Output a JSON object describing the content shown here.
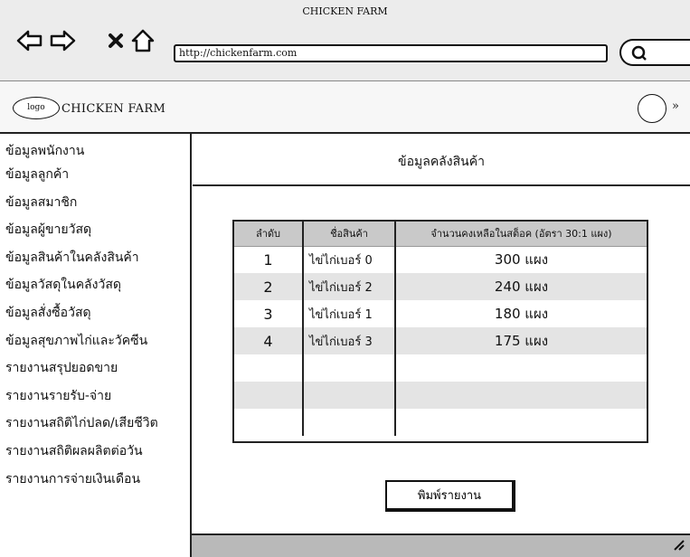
{
  "window": {
    "title": "CHICKEN FARM"
  },
  "browser": {
    "url": "http://chickenfarm.com",
    "back_icon": "back-arrow-icon",
    "forward_icon": "forward-arrow-icon",
    "close_icon": "close-icon",
    "home_icon": "home-icon",
    "search_icon": "search-icon"
  },
  "header": {
    "logo_text": "logo",
    "site_name": "CHICKEN FARM",
    "chevron": "»"
  },
  "sidebar": {
    "items": [
      {
        "label": "ข้อมูลพนักงาน"
      },
      {
        "label": "ข้อมูลลูกค้า"
      },
      {
        "label": "ข้อมูลสมาชิก"
      },
      {
        "label": "ข้อมูลผู้ขายวัสดุ"
      },
      {
        "label": "ข้อมูลสินค้าในคลังสินค้า"
      },
      {
        "label": "ข้อมูลวัสดุในคลังวัสดุ"
      },
      {
        "label": "ข้อมูลสั่งซื้อวัสดุ"
      },
      {
        "label": "ข้อมูลสุขภาพไก่และวัคซีน"
      },
      {
        "label": "รายงานสรุปยอดขาย"
      },
      {
        "label": "รายงานรายรับ-จ่าย"
      },
      {
        "label": "รายงานสถิติไก่ปลด/เสียชีวิต"
      },
      {
        "label": "รายงานสถิติผลผลิตต่อวัน"
      },
      {
        "label": "รายงานการจ่ายเงินเดือน"
      }
    ]
  },
  "main": {
    "title": "ข้อมูลคลังสินค้า",
    "table": {
      "headers": [
        "ลำดับ",
        "ชื่อสินค้า",
        "จำนวนคงเหลือในสต็อค (อัตรา 30:1 แผง)"
      ],
      "rows": [
        {
          "no": "1",
          "name": "ไข่ไก่เบอร์ 0",
          "qty": "300 แผง"
        },
        {
          "no": "2",
          "name": "ไข่ไก่เบอร์ 2",
          "qty": "240 แผง"
        },
        {
          "no": "3",
          "name": "ไข่ไก่เบอร์ 1",
          "qty": "180 แผง"
        },
        {
          "no": "4",
          "name": "ไข่ไก่เบอร์ 3",
          "qty": "175 แผง"
        },
        {
          "no": "",
          "name": "",
          "qty": ""
        },
        {
          "no": "",
          "name": "",
          "qty": ""
        },
        {
          "no": "",
          "name": "",
          "qty": ""
        }
      ]
    },
    "print_label": "พิมพ์รายงาน"
  }
}
